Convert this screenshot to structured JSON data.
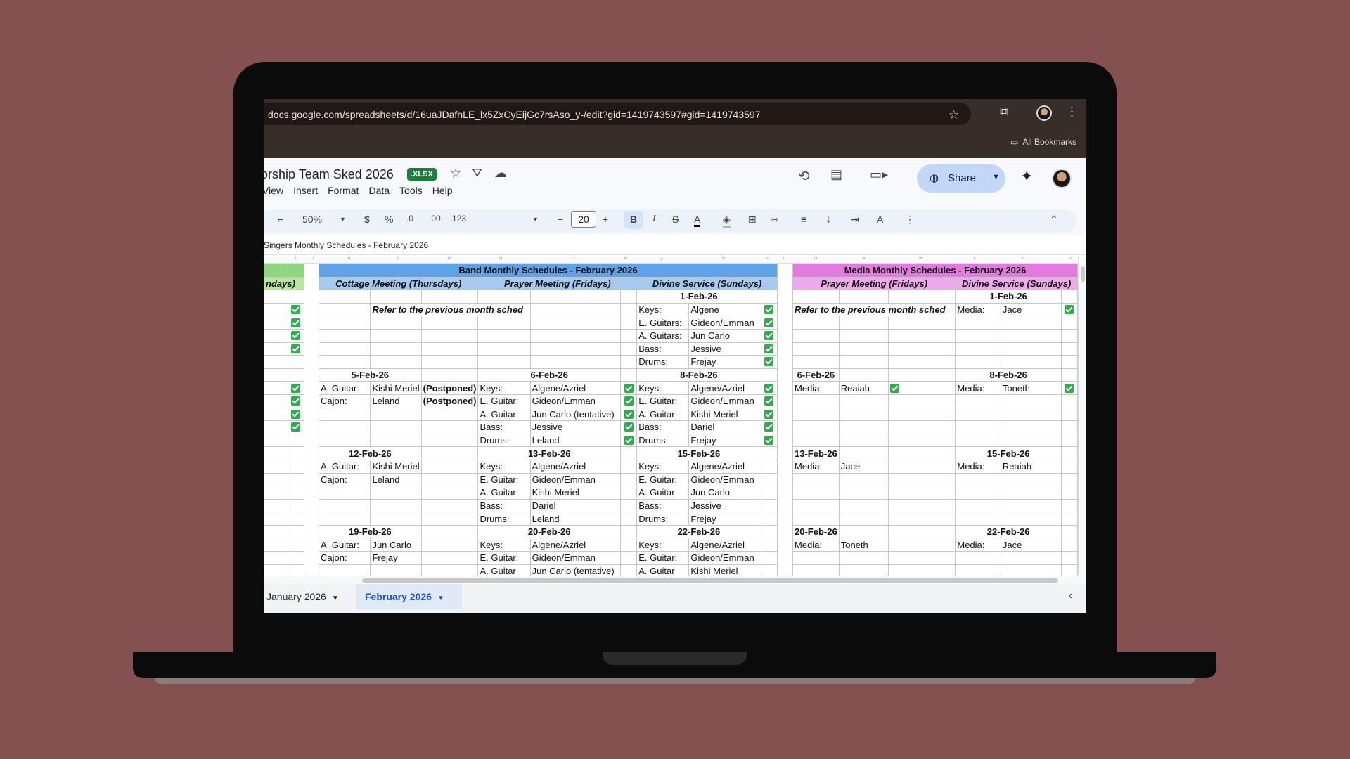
{
  "browser": {
    "url": "docs.google.com/spreadsheets/d/16uaJDafnLE_lx5ZxCyEijGc7rsAso_y-/edit?gid=1419743597#gid=1419743597",
    "bookmarks_label": "All Bookmarks"
  },
  "doc": {
    "title": "orship Team Sked 2026",
    "badge": ".XLSX",
    "menus": [
      "View",
      "Insert",
      "Format",
      "Data",
      "Tools",
      "Help"
    ],
    "share_label": "Share"
  },
  "toolbar": {
    "zoom": "50%",
    "currency": "$",
    "percent": "%",
    "dec_less": ".0",
    "dec_more": ".00",
    "number_format": "123",
    "font_size": "20"
  },
  "formula_bar": {
    "content": "Singers Monthly Schedules - February 2026"
  },
  "column_headers": [
    "I",
    "J",
    "K",
    "L",
    "M",
    "N",
    "O",
    "P",
    "Q",
    "R",
    "S",
    "T",
    "U",
    "V",
    "W",
    "X",
    "Y",
    "Z"
  ],
  "sheet": {
    "band_title": "Band Monthly Schedules - February 2026",
    "media_title": "Media Monthly Schedules - February 2026",
    "left_sub": "ndays)",
    "band_sub": [
      "Cottage Meeting (Thursdays)",
      "Prayer Meeting (Fridays)",
      "Divine Service (Sundays)"
    ],
    "media_sub": [
      "Prayer Meeting (Fridays)",
      "Divine Service (Sundays)"
    ],
    "refer_note": "Refer to the previous month sched",
    "dates": {
      "d1": "1-Feb-26",
      "d5": "5-Feb-26",
      "d6": "6-Feb-26",
      "d8": "8-Feb-26",
      "d12": "12-Feb-26",
      "d13": "13-Feb-26",
      "d15": "15-Feb-26",
      "d19": "19-Feb-26",
      "d20": "20-Feb-26",
      "d22": "22-Feb-26"
    },
    "postponed": "(Postponed)",
    "roles": {
      "keys": "Keys:",
      "eguitars": "E. Guitars:",
      "aguitars": "A. Guitars:",
      "bass": "Bass:",
      "drums": "Drums:",
      "aguitar_c": "A. Guitar:",
      "aguitar": "A. Guitar",
      "cajon": "Cajon:",
      "eguitar": "E. Guitar:",
      "media": "Media:"
    },
    "names": {
      "algene": "Algene",
      "algene_azriel": "Algene/Azriel",
      "gideon_emman": "Gideon/Emman",
      "jun_carlo": "Jun Carlo",
      "jun_carlo_t": "Jun Carlo (tentative)",
      "jessive": "Jessive",
      "frejay": "Frejay",
      "dariel": "Dariel",
      "kishi_meriel": "Kishi Meriel",
      "leland": "Leland",
      "jace": "Jace",
      "reaiah": "Reaiah",
      "toneth": "Toneth"
    }
  },
  "tabs": [
    "January 2026",
    "February 2026"
  ]
}
